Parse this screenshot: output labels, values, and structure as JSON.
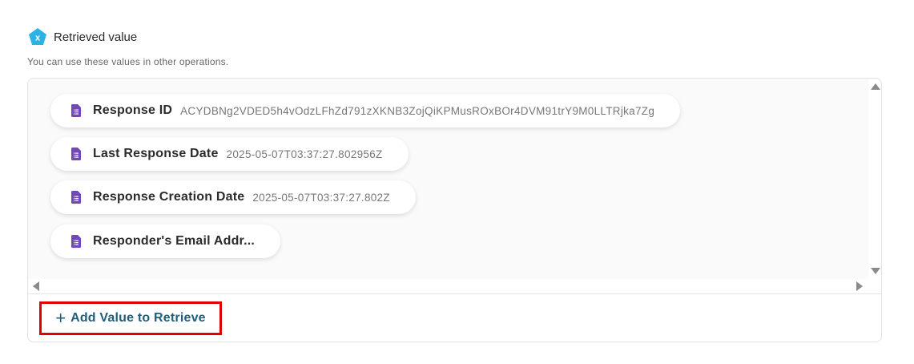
{
  "header": {
    "badge_icon": "variable-x-icon",
    "badge_letter": "x",
    "badge_color": "#2bb3e6",
    "title": "Retrieved value",
    "subtitle": "You can use these values in other operations."
  },
  "values": [
    {
      "label": "Response ID",
      "value": "ACYDBNg2VDED5h4vOdzLFhZd791zXKNB3ZojQiKPMusROxBOr4DVM91trY9M0LLTRjka7Zg",
      "icon": "google-forms-doc-icon"
    },
    {
      "label": "Last Response Date",
      "value": "2025-05-07T03:37:27.802956Z",
      "icon": "google-forms-doc-icon"
    },
    {
      "label": "Response Creation Date",
      "value": "2025-05-07T03:37:27.802Z",
      "icon": "google-forms-doc-icon"
    },
    {
      "label": "Responder's Email Addr...",
      "value": "",
      "icon": "google-forms-doc-icon"
    }
  ],
  "icon_color": "#7248b9",
  "add_button": {
    "label": "Add Value to Retrieve",
    "icon": "plus-icon",
    "plus_symbol": "+"
  }
}
